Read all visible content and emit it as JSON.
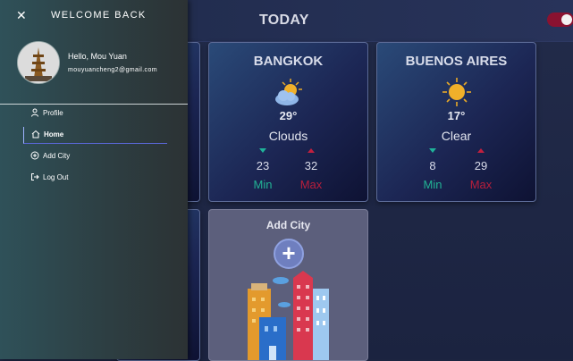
{
  "header": {
    "title": "TODAY"
  },
  "theme_toggle": {
    "state": "on",
    "accent": "#8a1230"
  },
  "cards": [
    {
      "city": "BANGKOK",
      "icon": "sun-behind-cloud-icon",
      "temp": "29°",
      "desc": "Clouds",
      "min": "23",
      "max": "32",
      "min_label": "Min",
      "max_label": "Max"
    },
    {
      "city": "BUENOS AIRES",
      "icon": "sun-icon",
      "temp": "17°",
      "desc": "Clear",
      "min": "8",
      "max": "29",
      "min_label": "Min",
      "max_label": "Max"
    }
  ],
  "add_city_card": {
    "title": "Add City",
    "icon": "plus-icon"
  },
  "drawer": {
    "close_icon": "close-icon",
    "title": "WELCOME BACK",
    "greeting": "Hello, Mou Yuan",
    "email": "mouyuancheng2@gmail.com",
    "items": [
      {
        "label": "Profile",
        "icon": "person-icon"
      },
      {
        "label": "Home",
        "icon": "home-icon",
        "active": true
      },
      {
        "label": "Add City",
        "icon": "plus-circle-icon"
      },
      {
        "label": "Log Out",
        "icon": "logout-icon"
      }
    ]
  },
  "colors": {
    "min": "#22b394",
    "max": "#b81e3c"
  }
}
